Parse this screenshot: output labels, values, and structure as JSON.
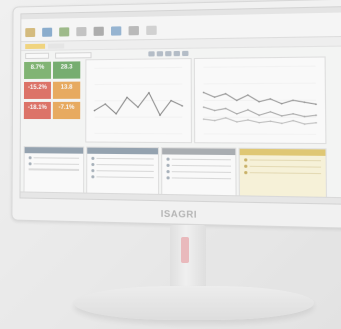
{
  "brand": {
    "logo_text": "ISAGRI"
  },
  "kpis": [
    {
      "value": "8.7%",
      "color": "#4e9a3b"
    },
    {
      "value": "28.3",
      "color": "#3f8f35"
    },
    {
      "value": "-15.2%",
      "color": "#d43a2a"
    },
    {
      "value": "13.8",
      "color": "#e58b1e"
    },
    {
      "value": "-18.1%",
      "color": "#d43a2a"
    },
    {
      "value": "-7.1%",
      "color": "#e58b1e"
    }
  ],
  "colors": {
    "accent_tab": "#f2c94c",
    "panel_header": "#6b7f93",
    "warning_panel": "#d9b53c"
  },
  "icons": [
    "folder-icon",
    "chart-icon",
    "table-icon",
    "calculator-icon",
    "print-icon",
    "export-icon",
    "settings-icon",
    "help-icon"
  ],
  "chart_left": {
    "points": [
      0.35,
      0.45,
      0.3,
      0.55,
      0.4,
      0.62,
      0.28,
      0.5,
      0.42
    ]
  },
  "chart_right": {
    "series": [
      {
        "points": [
          0.62,
          0.55,
          0.6,
          0.5,
          0.58,
          0.48,
          0.52,
          0.45,
          0.5,
          0.47,
          0.44
        ]
      },
      {
        "points": [
          0.4,
          0.35,
          0.38,
          0.3,
          0.36,
          0.28,
          0.33,
          0.27,
          0.3,
          0.26,
          0.28
        ]
      },
      {
        "points": [
          0.22,
          0.2,
          0.24,
          0.18,
          0.21,
          0.17,
          0.19,
          0.16,
          0.2,
          0.15,
          0.17
        ]
      }
    ]
  }
}
